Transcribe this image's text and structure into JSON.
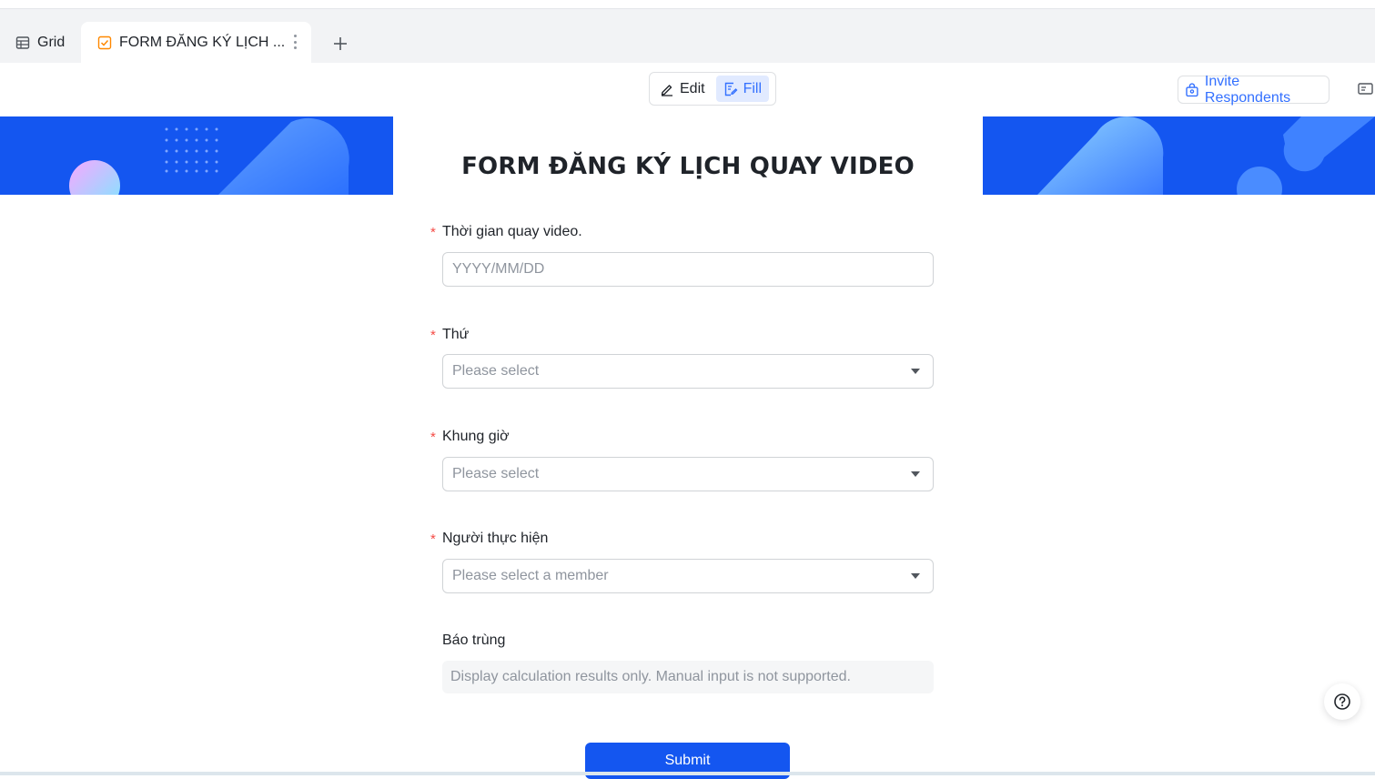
{
  "tabs": [
    {
      "label": "Grid",
      "icon": "grid-table-icon"
    },
    {
      "label": "FORM ĐĂNG KÝ LỊCH ...",
      "icon": "form-icon",
      "active": true
    }
  ],
  "toolbar": {
    "edit_label": "Edit",
    "fill_label": "Fill",
    "invite_label": "Invite Respondents"
  },
  "form": {
    "title": "FORM ĐĂNG KÝ LỊCH QUAY VIDEO",
    "fields": [
      {
        "label": "Thời gian quay video.",
        "required": "*",
        "placeholder": "YYYY/MM/DD"
      },
      {
        "label": "Thứ",
        "required": "*",
        "placeholder": "Please select"
      },
      {
        "label": "Khung giờ",
        "required": "*",
        "placeholder": "Please select"
      },
      {
        "label": "Người thực hiện",
        "required": "*",
        "placeholder": "Please select a member"
      },
      {
        "label": "Báo trùng",
        "placeholder": "Display calculation results only. Manual input is not supported."
      }
    ],
    "submit_label": "Submit"
  },
  "colors": {
    "accent": "#3370ff",
    "banner": "#1456f0",
    "required": "#f54a45"
  }
}
